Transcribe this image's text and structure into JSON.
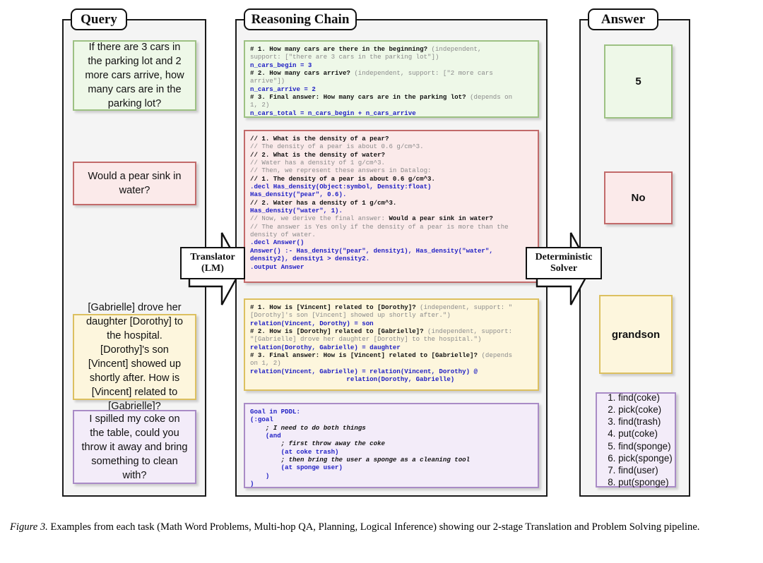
{
  "figure": {
    "caption_label": "Figure 3.",
    "caption_text": " Examples from each task (Math Word Problems, Multi-hop QA, Planning, Logical Inference) showing our 2-stage Translation and Problem Solving pipeline."
  },
  "panels": {
    "query": {
      "title": "Query"
    },
    "reasoning": {
      "title": "Reasoning Chain"
    },
    "answer": {
      "title": "Answer"
    }
  },
  "arrows": {
    "translator": {
      "line1": "Translator",
      "line2": "(LM)"
    },
    "solver": {
      "line1": "Deterministic",
      "line2": "Solver"
    }
  },
  "colors": {
    "green_bg": "#eef8e8",
    "green_border": "#9dc183",
    "red_bg": "#fbeaea",
    "red_border": "#c26a6a",
    "yellow_bg": "#fdf6dd",
    "yellow_border": "#dcc060",
    "purple_bg": "#f3ecf9",
    "purple_border": "#a98bc6",
    "panel_bg": "#f4f4f4",
    "panel_border": "#1a1a1a",
    "code_keyword": "#1d1dc4",
    "code_comment": "#8b8b8b"
  },
  "queries": [
    {
      "id": "math",
      "color": "green",
      "text": "If there are 3 cars in the parking lot and 2 more cars arrive, how many cars are in the parking lot?"
    },
    {
      "id": "logic",
      "color": "red",
      "text": "Would a pear sink in water?"
    },
    {
      "id": "multihop",
      "color": "yellow",
      "text": "[Gabrielle] drove her daughter [Dorothy] to the hospital. [Dorothy]'s son [Vincent] showed up shortly after. How is [Vincent] related to [Gabrielle]?"
    },
    {
      "id": "planning",
      "color": "purple",
      "text": "I spilled my coke on the table, could you throw it away and bring something to clean with?"
    }
  ],
  "reasoning_chains": [
    {
      "id": "math-chain",
      "color": "green",
      "lines": [
        "# 1. How many cars are there in the beginning? (independent,",
        "support: [\"there are 3 cars in the parking lot\"])",
        "n_cars_begin = 3",
        "# 2. How many cars arrive? (independent, support: [\"2 more cars",
        "arrive\"])",
        "n_cars_arrive = 2",
        "# 3. Final answer: How many cars are in the parking lot? (depends on",
        "1, 2)",
        "n_cars_total = n_cars_begin + n_cars_arrive"
      ]
    },
    {
      "id": "logic-chain",
      "color": "red",
      "lines": [
        "// 1. What is the density of a pear?",
        "// The density of a pear is about 0.6 g/cm^3.",
        "// 2. What is the density of water?",
        "// Water has a density of 1 g/cm^3.",
        "// Then, we represent these answers in Datalog:",
        "// 1. The density of a pear is about 0.6 g/cm^3.",
        ".decl Has_density(Object:symbol, Density:float)",
        "Has_density(\"pear\", 0.6).",
        "// 2. Water has a density of 1 g/cm^3.",
        "Has_density(\"water\", 1).",
        "// Now, we derive the final answer: Would a pear sink in water?",
        "// The answer is Yes only if the density of a pear is more than the",
        "density of water.",
        ".decl Answer()",
        "Answer() :- Has_density(\"pear\", density1), Has_density(\"water\",",
        "density2), density1 > density2.",
        ".output Answer"
      ]
    },
    {
      "id": "multihop-chain",
      "color": "yellow",
      "lines": [
        "# 1. How is [Vincent] related to [Dorothy]? (independent, support: \"",
        "[Dorothy]'s son [Vincent] showed up shortly after.\")",
        "relation(Vincent, Dorothy) = son",
        "# 2. How is [Dorothy] related to [Gabrielle]? (independent, support:",
        "\"[Gabrielle] drove her daughter [Dorothy] to the hospital.\")",
        "relation(Dorothy, Gabrielle) = daughter",
        "# 3. Final answer: How is [Vincent] related to [Gabrielle]? (depends",
        "on 1, 2)",
        "relation(Vincent, Gabrielle) = relation(Vincent, Dorothy) @",
        "                         relation(Dorothy, Gabrielle)"
      ]
    },
    {
      "id": "planning-chain",
      "color": "purple",
      "lines": [
        "Goal in PDDL:",
        "(:goal",
        "    ; I need to do both things",
        "    (and",
        "        ; first throw away the coke",
        "        (at coke trash)",
        "        ; then bring the user a sponge as a cleaning tool",
        "        (at sponge user)",
        "    )",
        ")"
      ]
    }
  ],
  "answers": [
    {
      "id": "math-answer",
      "color": "green",
      "text": "5"
    },
    {
      "id": "logic-answer",
      "color": "red",
      "text": "No"
    },
    {
      "id": "multihop-answer",
      "color": "yellow",
      "text": "grandson"
    },
    {
      "id": "planning-answer",
      "color": "purple",
      "steps": [
        "1. find(coke)",
        "2. pick(coke)",
        "3. find(trash)",
        "4. put(coke)",
        "5. find(sponge)",
        "6. pick(sponge)",
        "7. find(user)",
        "8. put(sponge)"
      ]
    }
  ]
}
